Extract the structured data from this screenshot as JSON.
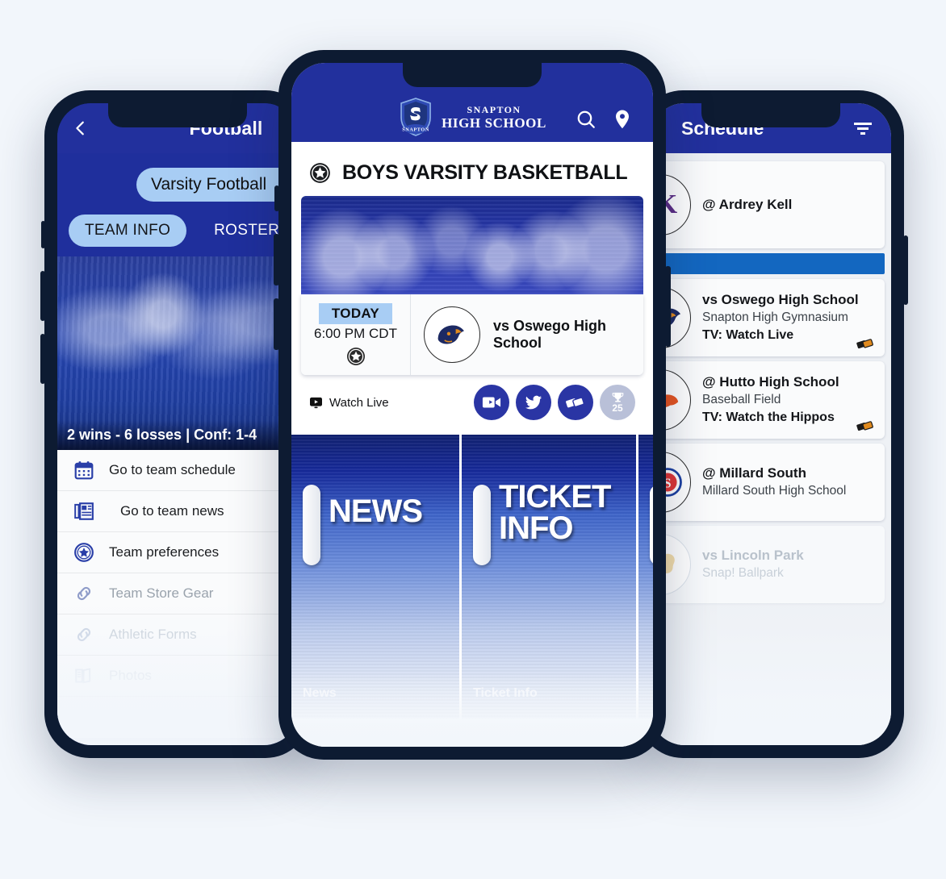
{
  "app": {
    "background_color": "#f2f6fb",
    "brand_blue": "#22309d",
    "frame_color": "#0d1b32",
    "accent_light_blue": "#a8cdf4",
    "divider_blue": "#1367c0"
  },
  "left_phone": {
    "nav": {
      "back_icon": "chevron-left-icon",
      "title": "Football"
    },
    "team_selector": {
      "value": "Varsity Football"
    },
    "tabs": [
      {
        "label": "TEAM INFO",
        "active": true
      },
      {
        "label": "ROSTER",
        "active": false
      }
    ],
    "hero": {
      "record": "2 wins - 6 losses | Conf: 1-4"
    },
    "menu": [
      {
        "icon": "calendar-icon",
        "label": "Go to team schedule",
        "state": "normal"
      },
      {
        "icon": "news-icon",
        "label": "Go to team news",
        "state": "normal"
      },
      {
        "icon": "star-badge-icon",
        "label": "Team preferences",
        "state": "normal"
      },
      {
        "icon": "link-icon",
        "label": "Team Store Gear",
        "state": "dim"
      },
      {
        "icon": "link-icon",
        "label": "Athletic Forms",
        "state": "dim2"
      },
      {
        "icon": "book-icon",
        "label": "Photos",
        "state": "dim3"
      }
    ]
  },
  "center_phone": {
    "nav": {
      "logo_line1": "SNAPTON",
      "logo_line2": "HIGH SCHOOL",
      "shield_text": "SNAPTON",
      "search_icon": "search-icon",
      "location_icon": "location-pin-icon"
    },
    "page_title": {
      "icon": "star-badge-icon",
      "text": "BOYS VARSITY BASKETBALL"
    },
    "game_card": {
      "day_badge": "TODAY",
      "time": "6:00 PM CDT",
      "star_icon": "star-badge-icon",
      "opponent": "vs Oswego High School",
      "opponent_logo": "panther-logo"
    },
    "actions": {
      "watch_live_icon": "video-play-icon",
      "watch_live_label": "Watch Live",
      "buttons": [
        {
          "icon": "video-camera-icon",
          "name": "video-button",
          "muted": false
        },
        {
          "icon": "twitter-bird-icon",
          "name": "twitter-button",
          "muted": false
        },
        {
          "icon": "tickets-icon",
          "name": "tickets-button",
          "muted": false
        },
        {
          "icon": "trophy-icon",
          "name": "rewards-button",
          "muted": true,
          "count": "25"
        }
      ]
    },
    "tiles": [
      {
        "big": "NEWS",
        "caption": "News"
      },
      {
        "big": "TICKET INFO",
        "caption": "Ticket Info"
      },
      {
        "big": "",
        "caption": ""
      }
    ]
  },
  "right_phone": {
    "nav": {
      "title": "Schedule",
      "filter_icon": "filter-icon"
    },
    "games": [
      {
        "opponent": "@ Ardrey Kell",
        "venue": "",
        "tv": "",
        "logo": "ak-logo",
        "has_ticket": false,
        "faded": false
      },
      {
        "opponent": "vs Oswego High School",
        "venue": "Snapton High Gymnasium",
        "tv": "TV: Watch Live",
        "logo": "panther-logo",
        "has_ticket": true,
        "faded": false
      },
      {
        "opponent": "@ Hutto High School",
        "venue": "Baseball Field",
        "tv": "TV: Watch the Hippos",
        "logo": "hippo-logo",
        "has_ticket": true,
        "faded": false
      },
      {
        "opponent": "@ Millard South",
        "venue": "Millard South High School",
        "tv": "",
        "logo": "ms-logo",
        "has_ticket": false,
        "faded": false
      },
      {
        "opponent": "vs Lincoln Park",
        "venue": "Snap! Ballpark",
        "tv": "",
        "logo": "lion-logo",
        "has_ticket": false,
        "faded": true
      }
    ]
  }
}
